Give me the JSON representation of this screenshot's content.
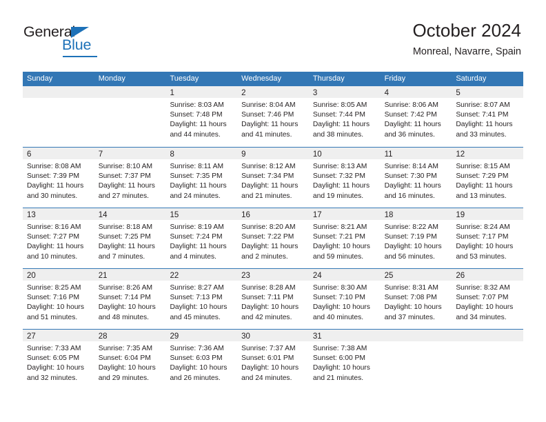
{
  "brand": {
    "name_part1": "General",
    "name_part2": "Blue",
    "accent_color": "#1d71b8"
  },
  "header": {
    "title": "October 2024",
    "subtitle": "Monreal, Navarre, Spain"
  },
  "theme": {
    "header_blue": "#3377b5",
    "daynum_band": "#efefef",
    "text": "#231f20"
  },
  "labels": {
    "sunrise_prefix": "Sunrise:",
    "sunset_prefix": "Sunset:",
    "daylight_prefix": "Daylight:"
  },
  "day_headers": [
    "Sunday",
    "Monday",
    "Tuesday",
    "Wednesday",
    "Thursday",
    "Friday",
    "Saturday"
  ],
  "weeks": [
    [
      {
        "empty": true
      },
      {
        "empty": true
      },
      {
        "day": "1",
        "sunrise": "Sunrise: 8:03 AM",
        "sunset": "Sunset: 7:48 PM",
        "daylight1": "Daylight: 11 hours",
        "daylight2": "and 44 minutes."
      },
      {
        "day": "2",
        "sunrise": "Sunrise: 8:04 AM",
        "sunset": "Sunset: 7:46 PM",
        "daylight1": "Daylight: 11 hours",
        "daylight2": "and 41 minutes."
      },
      {
        "day": "3",
        "sunrise": "Sunrise: 8:05 AM",
        "sunset": "Sunset: 7:44 PM",
        "daylight1": "Daylight: 11 hours",
        "daylight2": "and 38 minutes."
      },
      {
        "day": "4",
        "sunrise": "Sunrise: 8:06 AM",
        "sunset": "Sunset: 7:42 PM",
        "daylight1": "Daylight: 11 hours",
        "daylight2": "and 36 minutes."
      },
      {
        "day": "5",
        "sunrise": "Sunrise: 8:07 AM",
        "sunset": "Sunset: 7:41 PM",
        "daylight1": "Daylight: 11 hours",
        "daylight2": "and 33 minutes."
      }
    ],
    [
      {
        "day": "6",
        "sunrise": "Sunrise: 8:08 AM",
        "sunset": "Sunset: 7:39 PM",
        "daylight1": "Daylight: 11 hours",
        "daylight2": "and 30 minutes."
      },
      {
        "day": "7",
        "sunrise": "Sunrise: 8:10 AM",
        "sunset": "Sunset: 7:37 PM",
        "daylight1": "Daylight: 11 hours",
        "daylight2": "and 27 minutes."
      },
      {
        "day": "8",
        "sunrise": "Sunrise: 8:11 AM",
        "sunset": "Sunset: 7:35 PM",
        "daylight1": "Daylight: 11 hours",
        "daylight2": "and 24 minutes."
      },
      {
        "day": "9",
        "sunrise": "Sunrise: 8:12 AM",
        "sunset": "Sunset: 7:34 PM",
        "daylight1": "Daylight: 11 hours",
        "daylight2": "and 21 minutes."
      },
      {
        "day": "10",
        "sunrise": "Sunrise: 8:13 AM",
        "sunset": "Sunset: 7:32 PM",
        "daylight1": "Daylight: 11 hours",
        "daylight2": "and 19 minutes."
      },
      {
        "day": "11",
        "sunrise": "Sunrise: 8:14 AM",
        "sunset": "Sunset: 7:30 PM",
        "daylight1": "Daylight: 11 hours",
        "daylight2": "and 16 minutes."
      },
      {
        "day": "12",
        "sunrise": "Sunrise: 8:15 AM",
        "sunset": "Sunset: 7:29 PM",
        "daylight1": "Daylight: 11 hours",
        "daylight2": "and 13 minutes."
      }
    ],
    [
      {
        "day": "13",
        "sunrise": "Sunrise: 8:16 AM",
        "sunset": "Sunset: 7:27 PM",
        "daylight1": "Daylight: 11 hours",
        "daylight2": "and 10 minutes."
      },
      {
        "day": "14",
        "sunrise": "Sunrise: 8:18 AM",
        "sunset": "Sunset: 7:25 PM",
        "daylight1": "Daylight: 11 hours",
        "daylight2": "and 7 minutes."
      },
      {
        "day": "15",
        "sunrise": "Sunrise: 8:19 AM",
        "sunset": "Sunset: 7:24 PM",
        "daylight1": "Daylight: 11 hours",
        "daylight2": "and 4 minutes."
      },
      {
        "day": "16",
        "sunrise": "Sunrise: 8:20 AM",
        "sunset": "Sunset: 7:22 PM",
        "daylight1": "Daylight: 11 hours",
        "daylight2": "and 2 minutes."
      },
      {
        "day": "17",
        "sunrise": "Sunrise: 8:21 AM",
        "sunset": "Sunset: 7:21 PM",
        "daylight1": "Daylight: 10 hours",
        "daylight2": "and 59 minutes."
      },
      {
        "day": "18",
        "sunrise": "Sunrise: 8:22 AM",
        "sunset": "Sunset: 7:19 PM",
        "daylight1": "Daylight: 10 hours",
        "daylight2": "and 56 minutes."
      },
      {
        "day": "19",
        "sunrise": "Sunrise: 8:24 AM",
        "sunset": "Sunset: 7:17 PM",
        "daylight1": "Daylight: 10 hours",
        "daylight2": "and 53 minutes."
      }
    ],
    [
      {
        "day": "20",
        "sunrise": "Sunrise: 8:25 AM",
        "sunset": "Sunset: 7:16 PM",
        "daylight1": "Daylight: 10 hours",
        "daylight2": "and 51 minutes."
      },
      {
        "day": "21",
        "sunrise": "Sunrise: 8:26 AM",
        "sunset": "Sunset: 7:14 PM",
        "daylight1": "Daylight: 10 hours",
        "daylight2": "and 48 minutes."
      },
      {
        "day": "22",
        "sunrise": "Sunrise: 8:27 AM",
        "sunset": "Sunset: 7:13 PM",
        "daylight1": "Daylight: 10 hours",
        "daylight2": "and 45 minutes."
      },
      {
        "day": "23",
        "sunrise": "Sunrise: 8:28 AM",
        "sunset": "Sunset: 7:11 PM",
        "daylight1": "Daylight: 10 hours",
        "daylight2": "and 42 minutes."
      },
      {
        "day": "24",
        "sunrise": "Sunrise: 8:30 AM",
        "sunset": "Sunset: 7:10 PM",
        "daylight1": "Daylight: 10 hours",
        "daylight2": "and 40 minutes."
      },
      {
        "day": "25",
        "sunrise": "Sunrise: 8:31 AM",
        "sunset": "Sunset: 7:08 PM",
        "daylight1": "Daylight: 10 hours",
        "daylight2": "and 37 minutes."
      },
      {
        "day": "26",
        "sunrise": "Sunrise: 8:32 AM",
        "sunset": "Sunset: 7:07 PM",
        "daylight1": "Daylight: 10 hours",
        "daylight2": "and 34 minutes."
      }
    ],
    [
      {
        "day": "27",
        "sunrise": "Sunrise: 7:33 AM",
        "sunset": "Sunset: 6:05 PM",
        "daylight1": "Daylight: 10 hours",
        "daylight2": "and 32 minutes."
      },
      {
        "day": "28",
        "sunrise": "Sunrise: 7:35 AM",
        "sunset": "Sunset: 6:04 PM",
        "daylight1": "Daylight: 10 hours",
        "daylight2": "and 29 minutes."
      },
      {
        "day": "29",
        "sunrise": "Sunrise: 7:36 AM",
        "sunset": "Sunset: 6:03 PM",
        "daylight1": "Daylight: 10 hours",
        "daylight2": "and 26 minutes."
      },
      {
        "day": "30",
        "sunrise": "Sunrise: 7:37 AM",
        "sunset": "Sunset: 6:01 PM",
        "daylight1": "Daylight: 10 hours",
        "daylight2": "and 24 minutes."
      },
      {
        "day": "31",
        "sunrise": "Sunrise: 7:38 AM",
        "sunset": "Sunset: 6:00 PM",
        "daylight1": "Daylight: 10 hours",
        "daylight2": "and 21 minutes."
      },
      {
        "empty": true
      },
      {
        "empty": true
      }
    ]
  ]
}
